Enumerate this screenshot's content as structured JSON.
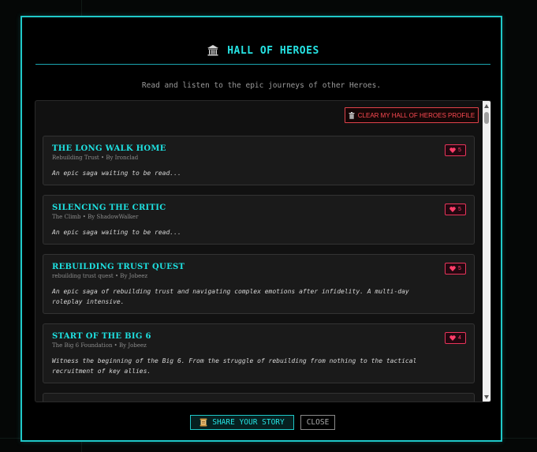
{
  "modal": {
    "title": "HALL OF HEROES",
    "title_icon": "museum-icon",
    "subtitle": "Read and listen to the epic journeys of other Heroes.",
    "clear_button_label": "CLEAR MY HALL OF HEROES PROFILE",
    "clear_button_icon": "trash-icon",
    "stories": [
      {
        "title": "THE LONG WALK HOME",
        "meta": "Rebuilding Trust • By Ironclad",
        "description": "An epic saga waiting to be read...",
        "likes": "5"
      },
      {
        "title": "SILENCING THE CRITIC",
        "meta": "The Climb • By ShadowWalker",
        "description": "An epic saga waiting to be read...",
        "likes": "5"
      },
      {
        "title": "REBUILDING TRUST QUEST",
        "meta": "rebuilding trust quest • By Jobeez",
        "description": "An epic saga of rebuilding trust and navigating complex emotions after infidelity. A multi-day roleplay intensive.",
        "likes": "5"
      },
      {
        "title": "START OF THE BIG 6",
        "meta": "The Big 6 Foundation • By Jobeez",
        "description": "Witness the beginning of the Big 6. From the struggle of rebuilding from nothing to the tactical recruitment of key allies.",
        "likes": "4"
      }
    ],
    "share_button_label": "SHARE YOUR STORY",
    "share_button_icon": "scroll-icon",
    "close_button_label": "CLOSE"
  },
  "colors": {
    "accent": "#26e3e3",
    "danger": "#ff4a52",
    "like": "#ff3d6a",
    "background": "#000000",
    "card": "#1a1a1a"
  }
}
